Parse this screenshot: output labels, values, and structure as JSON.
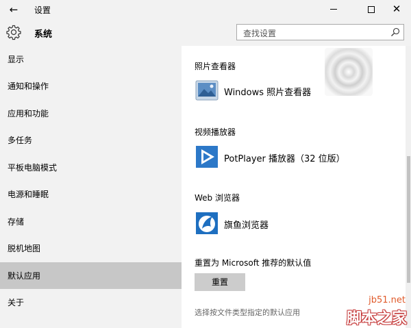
{
  "window": {
    "title": "设置",
    "back_glyph": "←",
    "minimize_label": "minimize",
    "maximize_label": "maximize",
    "close_glyph": "✕"
  },
  "header": {
    "icon": "gear-icon",
    "title": "系统",
    "search_placeholder": "查找设置",
    "search_icon": "search-icon"
  },
  "sidebar": {
    "items": [
      {
        "label": "显示"
      },
      {
        "label": "通知和操作"
      },
      {
        "label": "应用和功能"
      },
      {
        "label": "多任务"
      },
      {
        "label": "平板电脑模式"
      },
      {
        "label": "电源和睡眠"
      },
      {
        "label": "存储"
      },
      {
        "label": "脱机地图"
      },
      {
        "label": "默认应用",
        "selected": true
      },
      {
        "label": "关于"
      }
    ]
  },
  "main": {
    "groups": [
      {
        "label": "照片查看器",
        "app": "Windows 照片查看器",
        "icon": "photo-viewer-icon"
      },
      {
        "label": "视频播放器",
        "app": "PotPlayer 播放器（32 位版）",
        "icon": "potplayer-icon"
      },
      {
        "label": "Web 浏览器",
        "app": "旗鱼浏览器",
        "icon": "browser-icon"
      }
    ],
    "reset_label": "重置为 Microsoft 推荐的默认值",
    "reset_button": "重置",
    "link_text": "选择按文件类型指定的默认应用"
  },
  "watermark": {
    "top": "jb51.net",
    "bottom": "脚本之家"
  },
  "colors": {
    "sidebar_bg": "#f2f2f2",
    "selected_bg": "#c7c7c7",
    "content_bg": "#ffffff",
    "button_bg": "#cccccc",
    "link": "#666666",
    "watermark_text": "#e05a2a"
  }
}
